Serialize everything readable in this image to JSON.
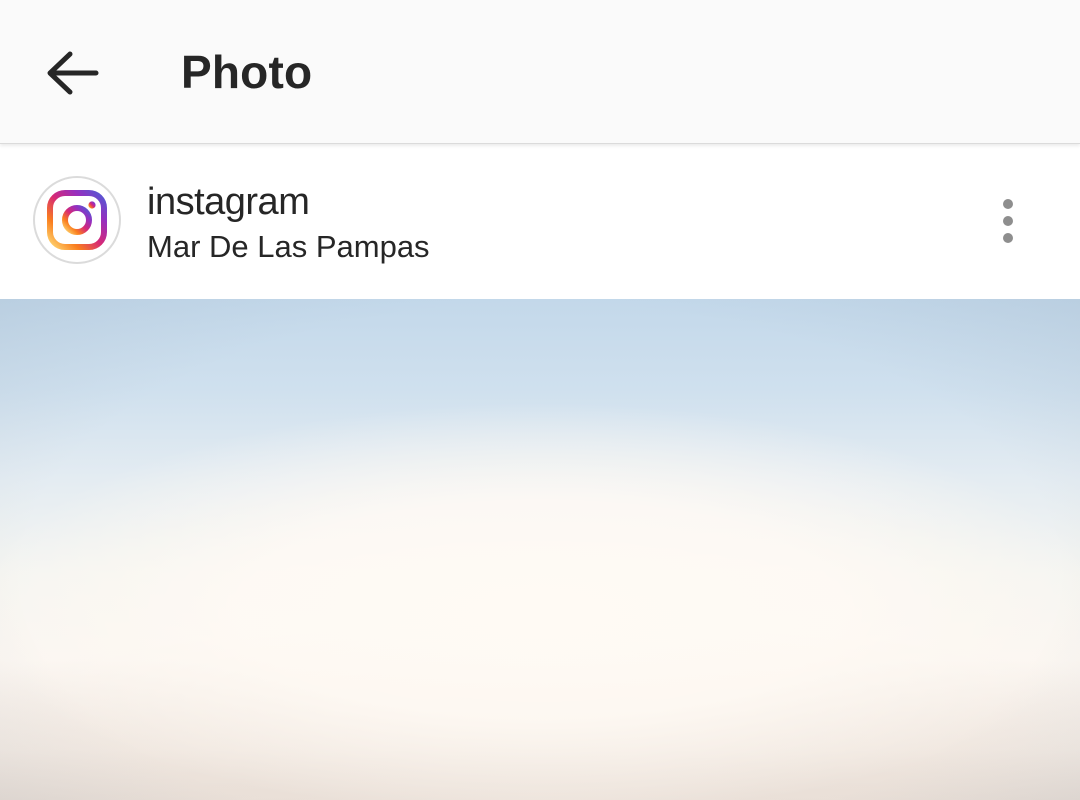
{
  "toolbar": {
    "back_icon": "arrow-left-icon",
    "title": "Photo"
  },
  "post": {
    "avatar_icon": "instagram-logo-icon",
    "username": "instagram",
    "location": "Mar De Las Pampas",
    "more_icon": "more-vertical-icon"
  },
  "colors": {
    "toolbar_bg": "#fafafa",
    "text_primary": "#262626",
    "icon_gray": "#8e8e8e",
    "divider": "#dbdbdb"
  }
}
